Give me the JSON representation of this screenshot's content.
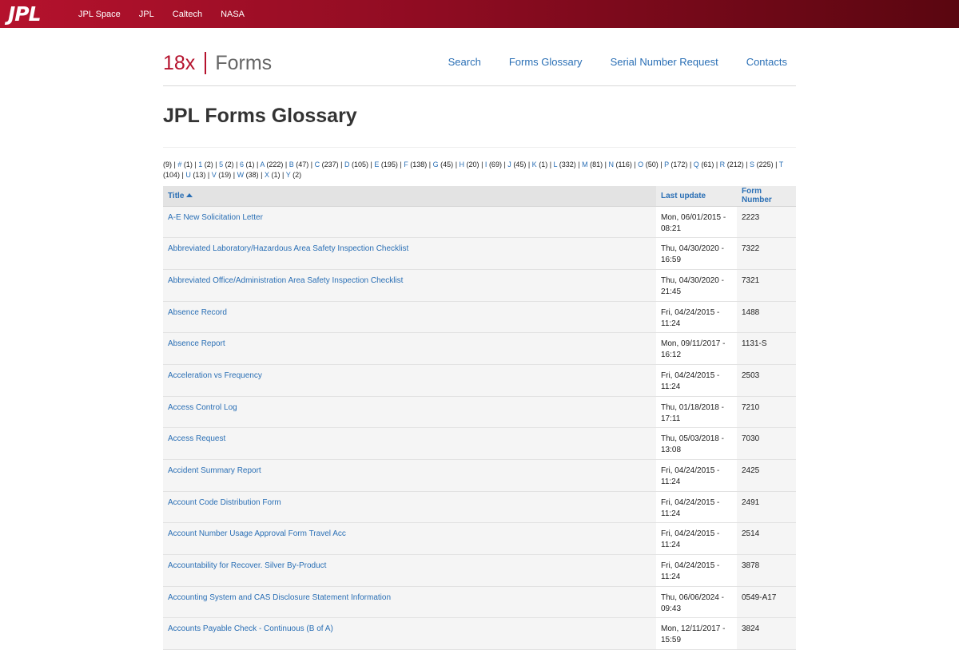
{
  "topbar": {
    "logo": "JPL",
    "links": [
      "JPL Space",
      "JPL",
      "Caltech",
      "NASA"
    ]
  },
  "site": {
    "number": "18x",
    "word": "Forms"
  },
  "nav": [
    "Search",
    "Forms Glossary",
    "Serial Number Request",
    "Contacts"
  ],
  "page_title": "JPL Forms Glossary",
  "alpha_index": [
    {
      "label": "(9)",
      "count": "",
      "link": false
    },
    {
      "label": "#",
      "count": "(1)",
      "link": true
    },
    {
      "label": "1",
      "count": "(2)",
      "link": true
    },
    {
      "label": "5",
      "count": "(2)",
      "link": true
    },
    {
      "label": "6",
      "count": "(1)",
      "link": true
    },
    {
      "label": "A",
      "count": "(222)",
      "link": true
    },
    {
      "label": "B",
      "count": "(47)",
      "link": true
    },
    {
      "label": "C",
      "count": "(237)",
      "link": true
    },
    {
      "label": "D",
      "count": "(105)",
      "link": true
    },
    {
      "label": "E",
      "count": "(195)",
      "link": true
    },
    {
      "label": "F",
      "count": "(138)",
      "link": true
    },
    {
      "label": "G",
      "count": "(45)",
      "link": true
    },
    {
      "label": "H",
      "count": "(20)",
      "link": true
    },
    {
      "label": "I",
      "count": "(69)",
      "link": true
    },
    {
      "label": "J",
      "count": "(45)",
      "link": true
    },
    {
      "label": "K",
      "count": "(1)",
      "link": true
    },
    {
      "label": "L",
      "count": "(332)",
      "link": true
    },
    {
      "label": "M",
      "count": "(81)",
      "link": true
    },
    {
      "label": "N",
      "count": "(116)",
      "link": true
    },
    {
      "label": "O",
      "count": "(50)",
      "link": true
    },
    {
      "label": "P",
      "count": "(172)",
      "link": true
    },
    {
      "label": "Q",
      "count": "(61)",
      "link": true
    },
    {
      "label": "R",
      "count": "(212)",
      "link": true
    },
    {
      "label": "S",
      "count": "(225)",
      "link": true
    },
    {
      "label": "T",
      "count": "(104)",
      "link": true
    },
    {
      "label": "U",
      "count": "(13)",
      "link": true
    },
    {
      "label": "V",
      "count": "(19)",
      "link": true
    },
    {
      "label": "W",
      "count": "(38)",
      "link": true
    },
    {
      "label": "X",
      "count": "(1)",
      "link": true
    },
    {
      "label": "Y",
      "count": "(2)",
      "link": true
    }
  ],
  "table": {
    "headers": {
      "title": "Title",
      "last_update": "Last update",
      "form_number": "Form Number"
    },
    "rows": [
      {
        "title": "A-E New Solicitation Letter",
        "date": "Mon, 06/01/2015 -",
        "time": "08:21",
        "form": "2223"
      },
      {
        "title": "Abbreviated Laboratory/Hazardous Area Safety Inspection Checklist",
        "date": "Thu, 04/30/2020 -",
        "time": "16:59",
        "form": "7322"
      },
      {
        "title": "Abbreviated Office/Administration Area Safety Inspection Checklist",
        "date": "Thu, 04/30/2020 -",
        "time": "21:45",
        "form": "7321"
      },
      {
        "title": "Absence Record",
        "date": "Fri, 04/24/2015 -",
        "time": "11:24",
        "form": "1488"
      },
      {
        "title": "Absence Report",
        "date": "Mon, 09/11/2017 -",
        "time": "16:12",
        "form": "1131-S"
      },
      {
        "title": "Acceleration vs Frequency",
        "date": "Fri, 04/24/2015 -",
        "time": "11:24",
        "form": "2503"
      },
      {
        "title": "Access Control Log",
        "date": "Thu, 01/18/2018 -",
        "time": "17:11",
        "form": "7210"
      },
      {
        "title": "Access Request",
        "date": "Thu, 05/03/2018 -",
        "time": "13:08",
        "form": "7030"
      },
      {
        "title": "Accident Summary Report",
        "date": "Fri, 04/24/2015 -",
        "time": "11:24",
        "form": "2425"
      },
      {
        "title": "Account Code Distribution Form",
        "date": "Fri, 04/24/2015 -",
        "time": "11:24",
        "form": "2491"
      },
      {
        "title": "Account Number Usage Approval Form Travel Acc",
        "date": "Fri, 04/24/2015 -",
        "time": "11:24",
        "form": "2514"
      },
      {
        "title": "Accountability for Recover. Silver By-Product",
        "date": "Fri, 04/24/2015 -",
        "time": "11:24",
        "form": "3878"
      },
      {
        "title": "Accounting System and CAS Disclosure Statement Information",
        "date": "Thu, 06/06/2024 -",
        "time": "09:43",
        "form": "0549-A17"
      },
      {
        "title": "Accounts Payable Check - Continuous (B of A)",
        "date": "Mon, 12/11/2017 -",
        "time": "15:59",
        "form": "3824"
      }
    ]
  }
}
